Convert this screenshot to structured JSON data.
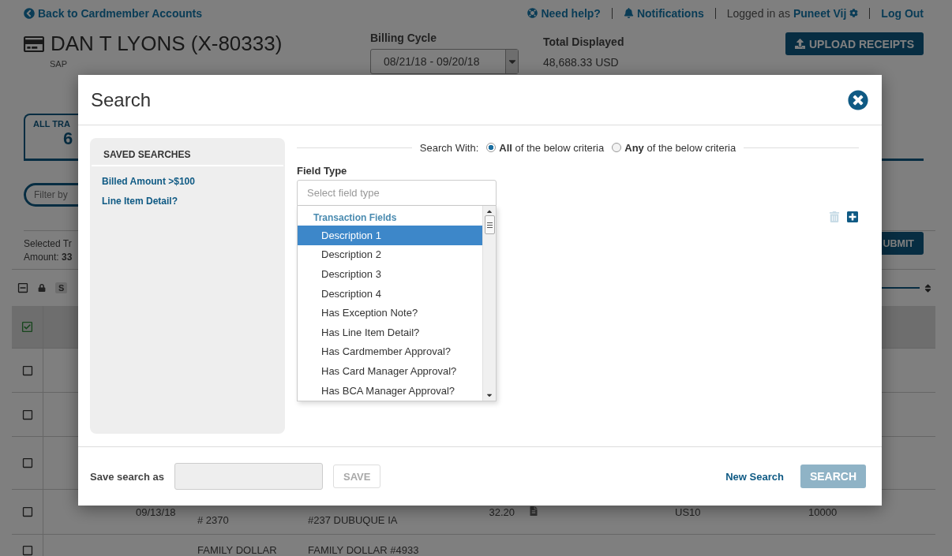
{
  "header": {
    "back_link": "Back to Cardmember Accounts",
    "help": "Need help?",
    "notifications": "Notifications",
    "logged_in_prefix": "Logged in as",
    "user": "Puneet Vij",
    "logout": "Log Out"
  },
  "account": {
    "name": "DAN T LYONS (X-80333)",
    "subtitle": "SAP",
    "billing_cycle_label": "Billing Cycle",
    "billing_cycle": "08/21/18 - 09/20/18",
    "total_label": "Total Displayed",
    "total": "48,688.33 USD",
    "upload_button": "UPLOAD RECEIPTS"
  },
  "tab": {
    "label": "ALL TRA",
    "count": "6",
    "selected": true
  },
  "filter": {
    "placeholder": "Filter by"
  },
  "selection": {
    "line1": "Selected Tr",
    "amount": "Amount: **33**"
  },
  "submit_button": "UBMIT",
  "table": {
    "header_badge": "S",
    "select_all": {
      "indeterminate": true
    },
    "rows": [
      {
        "checked": true
      },
      {
        "checked": false
      },
      {
        "checked": false
      },
      {
        "checked": false
      },
      {
        "checked": false,
        "date": "09/13/18",
        "merchant": "# 2370",
        "description": "#237 DUBUQUE IA",
        "amount": "32.20",
        "code": "US10",
        "account": "10000"
      },
      {
        "checked": false,
        "merchant": "FAMILY DOLLAR",
        "description": "FAMILY DOLLAR #4933"
      }
    ]
  },
  "search_dialog": {
    "title": "Search",
    "saved_searches": {
      "heading": "SAVED SEARCHES",
      "items": [
        "Billed Amount >$100",
        "Line Item Detail?"
      ]
    },
    "search_with": {
      "label": "Search With:",
      "options": [
        {
          "label": "**All** of the below criteria",
          "selected": true
        },
        {
          "label": "**Any** of the below criteria",
          "selected": false
        }
      ]
    },
    "field_type": {
      "label": "Field Type",
      "placeholder": "Select field type",
      "delete_disabled": true,
      "dropdown": {
        "group": "Transaction Fields",
        "options": [
          {
            "label": "Description 1",
            "selected": true
          },
          {
            "label": "Description 2",
            "selected": false
          },
          {
            "label": "Description 3",
            "selected": false
          },
          {
            "label": "Description 4",
            "selected": false
          },
          {
            "label": "Has Exception Note?",
            "selected": false
          },
          {
            "label": "Has Line Item Detail?",
            "selected": false
          },
          {
            "label": "Has Cardmember Approval?",
            "selected": false
          },
          {
            "label": "Has Card Manager Approval?",
            "selected": false
          },
          {
            "label": "Has BCA Manager Approval?",
            "selected": false
          }
        ]
      }
    },
    "save_label": "Save search as",
    "save_button": {
      "label": "SAVE",
      "disabled": true
    },
    "new_search": "New Search",
    "search_button": {
      "label": "SEARCH",
      "disabled": true
    }
  }
}
